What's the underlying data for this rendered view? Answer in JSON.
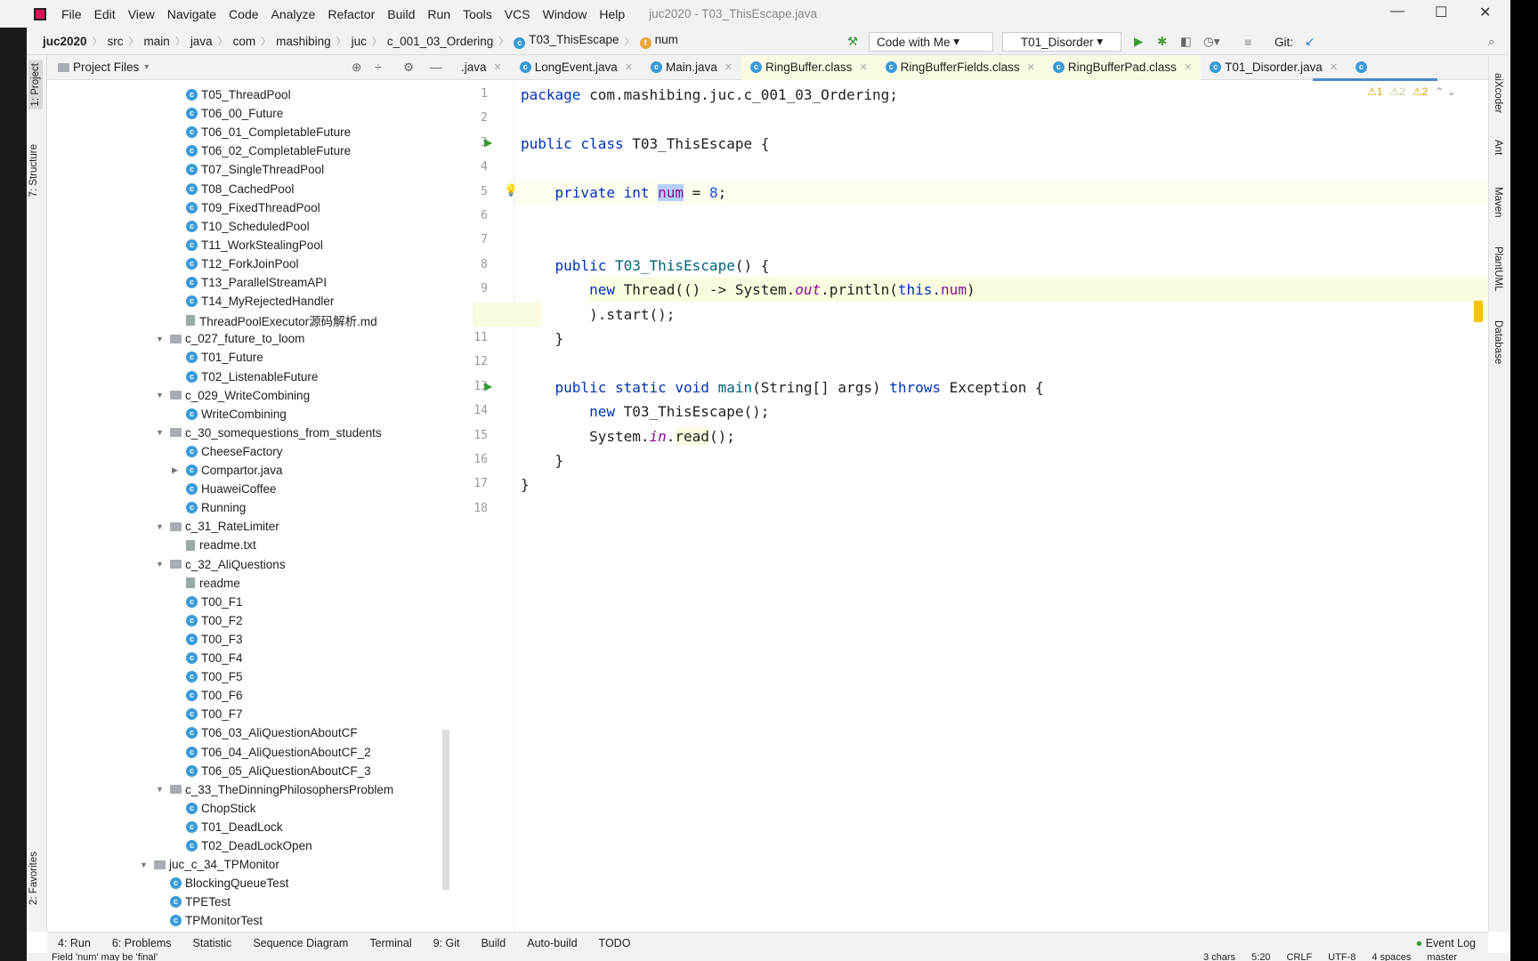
{
  "window": {
    "title": "juc2020 - T03_ThisEscape.java",
    "menu": [
      "File",
      "Edit",
      "View",
      "Navigate",
      "Code",
      "Analyze",
      "Refactor",
      "Build",
      "Run",
      "Tools",
      "VCS",
      "Window",
      "Help"
    ]
  },
  "breadcrumb": [
    "juc2020",
    "src",
    "main",
    "java",
    "com",
    "mashibing",
    "juc",
    "c_001_03_Ordering",
    "T03_ThisEscape",
    "num"
  ],
  "toolbar": {
    "code_with_me": "Code with Me",
    "run_config": "T01_Disorder",
    "git_label": "Git:"
  },
  "left_stripe": {
    "project": "1: Project",
    "structure": "7: Structure",
    "favorites": "2: Favorites"
  },
  "right_stripe": [
    "aiXcoder",
    "Ant",
    "Maven",
    "PlantUML",
    "Database"
  ],
  "project": {
    "title": "Project Files",
    "tree": [
      {
        "label": "T05_ThreadPool",
        "icon": "class",
        "level": 3
      },
      {
        "label": "T06_00_Future",
        "icon": "class",
        "level": 3
      },
      {
        "label": "T06_01_CompletableFuture",
        "icon": "class",
        "level": 3
      },
      {
        "label": "T06_02_CompletableFuture",
        "icon": "class",
        "level": 3
      },
      {
        "label": "T07_SingleThreadPool",
        "icon": "class",
        "level": 3
      },
      {
        "label": "T08_CachedPool",
        "icon": "class",
        "level": 3
      },
      {
        "label": "T09_FixedThreadPool",
        "icon": "class",
        "level": 3
      },
      {
        "label": "T10_ScheduledPool",
        "icon": "class",
        "level": 3
      },
      {
        "label": "T11_WorkStealingPool",
        "icon": "class",
        "level": 3
      },
      {
        "label": "T12_ForkJoinPool",
        "icon": "class",
        "level": 3
      },
      {
        "label": "T13_ParallelStreamAPI",
        "icon": "class",
        "level": 3
      },
      {
        "label": "T14_MyRejectedHandler",
        "icon": "class",
        "level": 3
      },
      {
        "label": "ThreadPoolExecutor源码解析.md",
        "icon": "file",
        "level": 3
      },
      {
        "label": "c_027_future_to_loom",
        "icon": "folder",
        "level": 2,
        "arrow": "open"
      },
      {
        "label": "T01_Future",
        "icon": "class",
        "level": 3
      },
      {
        "label": "T02_ListenableFuture",
        "icon": "class",
        "level": 3
      },
      {
        "label": "c_029_WriteCombining",
        "icon": "folder",
        "level": 2,
        "arrow": "open"
      },
      {
        "label": "WriteCombining",
        "icon": "class",
        "level": 3
      },
      {
        "label": "c_30_somequestions_from_students",
        "icon": "folder",
        "level": 2,
        "arrow": "open"
      },
      {
        "label": "CheeseFactory",
        "icon": "class",
        "level": 3
      },
      {
        "label": "Compartor.java",
        "icon": "class",
        "level": 3,
        "arrow": "closed"
      },
      {
        "label": "HuaweiCoffee",
        "icon": "class",
        "level": 3
      },
      {
        "label": "Running",
        "icon": "class",
        "level": 3
      },
      {
        "label": "c_31_RateLimiter",
        "icon": "folder",
        "level": 2,
        "arrow": "open"
      },
      {
        "label": "readme.txt",
        "icon": "file",
        "level": 3
      },
      {
        "label": "c_32_AliQuestions",
        "icon": "folder",
        "level": 2,
        "arrow": "open"
      },
      {
        "label": "readme",
        "icon": "file",
        "level": 3
      },
      {
        "label": "T00_F1",
        "icon": "class",
        "level": 3
      },
      {
        "label": "T00_F2",
        "icon": "class",
        "level": 3
      },
      {
        "label": "T00_F3",
        "icon": "class",
        "level": 3
      },
      {
        "label": "T00_F4",
        "icon": "class",
        "level": 3
      },
      {
        "label": "T00_F5",
        "icon": "class",
        "level": 3
      },
      {
        "label": "T00_F6",
        "icon": "class",
        "level": 3
      },
      {
        "label": "T00_F7",
        "icon": "class",
        "level": 3
      },
      {
        "label": "T06_03_AliQuestionAboutCF",
        "icon": "class",
        "level": 3
      },
      {
        "label": "T06_04_AliQuestionAboutCF_2",
        "icon": "class",
        "level": 3
      },
      {
        "label": "T06_05_AliQuestionAboutCF_3",
        "icon": "class",
        "level": 3
      },
      {
        "label": "c_33_TheDinningPhilosophersProblem",
        "icon": "folder",
        "level": 2,
        "arrow": "open"
      },
      {
        "label": "ChopStick",
        "icon": "class",
        "level": 3
      },
      {
        "label": "T01_DeadLock",
        "icon": "class",
        "level": 3
      },
      {
        "label": "T02_DeadLockOpen",
        "icon": "class",
        "level": 3
      },
      {
        "label": "juc_c_34_TPMonitor",
        "icon": "folder",
        "level": 1,
        "arrow": "open"
      },
      {
        "label": "BlockingQueueTest",
        "icon": "class",
        "level": 2
      },
      {
        "label": "TPETest",
        "icon": "class",
        "level": 2
      },
      {
        "label": "TPMonitorTest",
        "icon": "class",
        "level": 2
      }
    ]
  },
  "tabs": [
    {
      "label": ".java"
    },
    {
      "label": "LongEvent.java"
    },
    {
      "label": "Main.java"
    },
    {
      "label": "RingBuffer.class",
      "yellow": true
    },
    {
      "label": "RingBufferFields.class",
      "yellow": true
    },
    {
      "label": "RingBufferPad.class",
      "yellow": true
    },
    {
      "label": "T01_Disorder.java"
    }
  ],
  "inspections": {
    "warnings": "1",
    "weak_warnings": "2",
    "typos": "2"
  },
  "editor": {
    "lines": [
      [
        [
          "package",
          "kw"
        ],
        [
          " com.mashibing.juc.c_001_03_Ordering;",
          ""
        ]
      ],
      [],
      [
        [
          "public class",
          "kw"
        ],
        [
          " T03_ThisEscape {",
          ""
        ]
      ],
      [],
      [
        [
          "    ",
          ""
        ],
        [
          "private int",
          "kw"
        ],
        [
          " ",
          ""
        ],
        [
          "num",
          "sel"
        ],
        [
          " = ",
          ""
        ],
        [
          "8",
          "num"
        ],
        [
          ";",
          ""
        ]
      ],
      [],
      [],
      [
        [
          "    ",
          ""
        ],
        [
          "public",
          "kw"
        ],
        [
          " ",
          ""
        ],
        [
          "T03_ThisEscape",
          "fn"
        ],
        [
          "() {",
          ""
        ]
      ],
      [
        [
          "        ",
          ""
        ],
        [
          "new",
          "kw"
        ],
        [
          " Thread(() -> System.",
          ""
        ],
        [
          "out",
          "it"
        ],
        [
          ".println(",
          ""
        ],
        [
          "this",
          "kw"
        ],
        [
          ".",
          ""
        ],
        [
          "num",
          "fld"
        ],
        [
          ")",
          ""
        ]
      ],
      [
        [
          "        ).start();",
          ""
        ]
      ],
      [
        [
          "    }",
          ""
        ]
      ],
      [],
      [
        [
          "    ",
          ""
        ],
        [
          "public static void",
          "kw"
        ],
        [
          " ",
          ""
        ],
        [
          "main",
          "fn"
        ],
        [
          "(String[] args) ",
          ""
        ],
        [
          "throws",
          "kw"
        ],
        [
          " Exception {",
          ""
        ]
      ],
      [
        [
          "        ",
          ""
        ],
        [
          "new",
          "kw"
        ],
        [
          " T03_ThisEscape();",
          ""
        ]
      ],
      [
        [
          "        System.",
          ""
        ],
        [
          "in",
          "it"
        ],
        [
          ".",
          ""
        ],
        [
          "read",
          "hl"
        ],
        [
          "();",
          ""
        ]
      ],
      [
        [
          "    }",
          ""
        ]
      ],
      [
        [
          "}",
          ""
        ]
      ],
      []
    ]
  },
  "bottom_tools": [
    "4: Run",
    "6: Problems",
    "Statistic",
    "Sequence Diagram",
    "Terminal",
    "9: Git",
    "Build",
    "Auto-build",
    "TODO"
  ],
  "event_log": "Event Log",
  "status": {
    "message": "Field 'num' may be 'final'",
    "right": [
      "3 chars",
      "5:20",
      "CRLF",
      "UTF-8",
      "4 spaces",
      "master"
    ]
  }
}
